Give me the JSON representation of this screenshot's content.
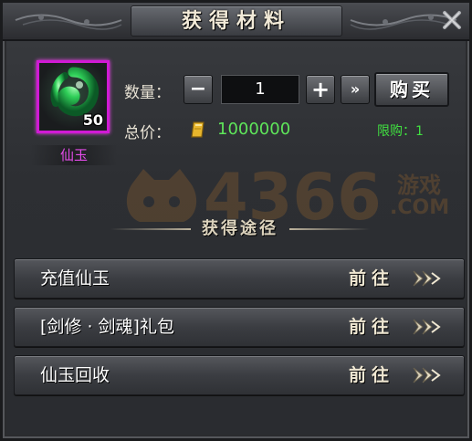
{
  "dialog": {
    "title": "获得材料"
  },
  "item": {
    "name": "仙玉",
    "count": "50",
    "icon": "jade-pendant-icon"
  },
  "purchase": {
    "quantity_label": "数量：",
    "quantity_value": "1",
    "minus_label": "−",
    "plus_label": "+",
    "max_label": "»",
    "buy_label": "购买",
    "price_label": "总价：",
    "price_value": "1000000",
    "price_icon": "gold-ingot-icon",
    "limit_text": "限购：1"
  },
  "watermark": {
    "number": "4366",
    "brand_cn": "游戏",
    "brand_com": ".COM"
  },
  "routes": {
    "title": "获得途径",
    "items": [
      {
        "label": "充值仙玉",
        "action": "前往"
      },
      {
        "label": "[剑修 · 剑魂]礼包",
        "action": "前往"
      },
      {
        "label": "仙玉回收",
        "action": "前往"
      }
    ]
  },
  "colors": {
    "item_frame": "#d01ad4",
    "item_name": "#e34be8",
    "price": "#5ee65a",
    "limit": "#40e040"
  }
}
